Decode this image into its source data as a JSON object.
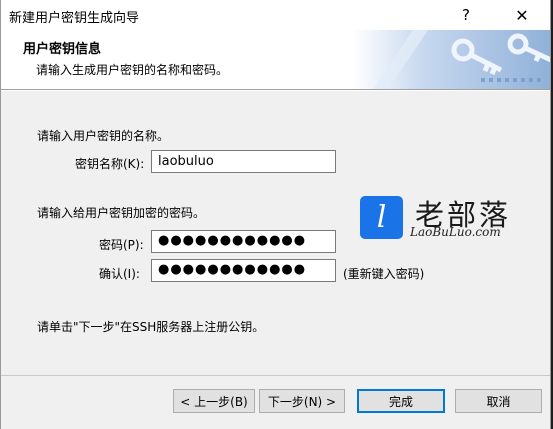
{
  "window": {
    "title": "新建用户密钥生成向导",
    "help_label": "?",
    "close_label": "✕"
  },
  "header": {
    "title": "用户密钥信息",
    "subtitle": "请输入生成用户密钥的名称和密码。"
  },
  "name_section": {
    "instruction": "请输入用户密钥的名称。",
    "label": "密钥名称(K):",
    "value": "laobuluo"
  },
  "password_section": {
    "instruction": "请输入给用户密钥加密的密码。",
    "password_label": "密码(P):",
    "password_value": "●●●●●●●●●●●●",
    "confirm_label": "确认(I):",
    "confirm_value": "●●●●●●●●●●●●",
    "confirm_hint": "(重新键入密码)"
  },
  "footer_note": "请单击\"下一步\"在SSH服务器上注册公钥。",
  "watermark": {
    "icon_letter": "l",
    "cn": "老部落",
    "en": "LaoBuLuo.com",
    "color": "#1b73e8"
  },
  "buttons": {
    "back": "< 上一步(B)",
    "next": "下一步(N) >",
    "finish": "完成",
    "cancel": "取消"
  },
  "icons": {
    "banner": "key-icon"
  }
}
